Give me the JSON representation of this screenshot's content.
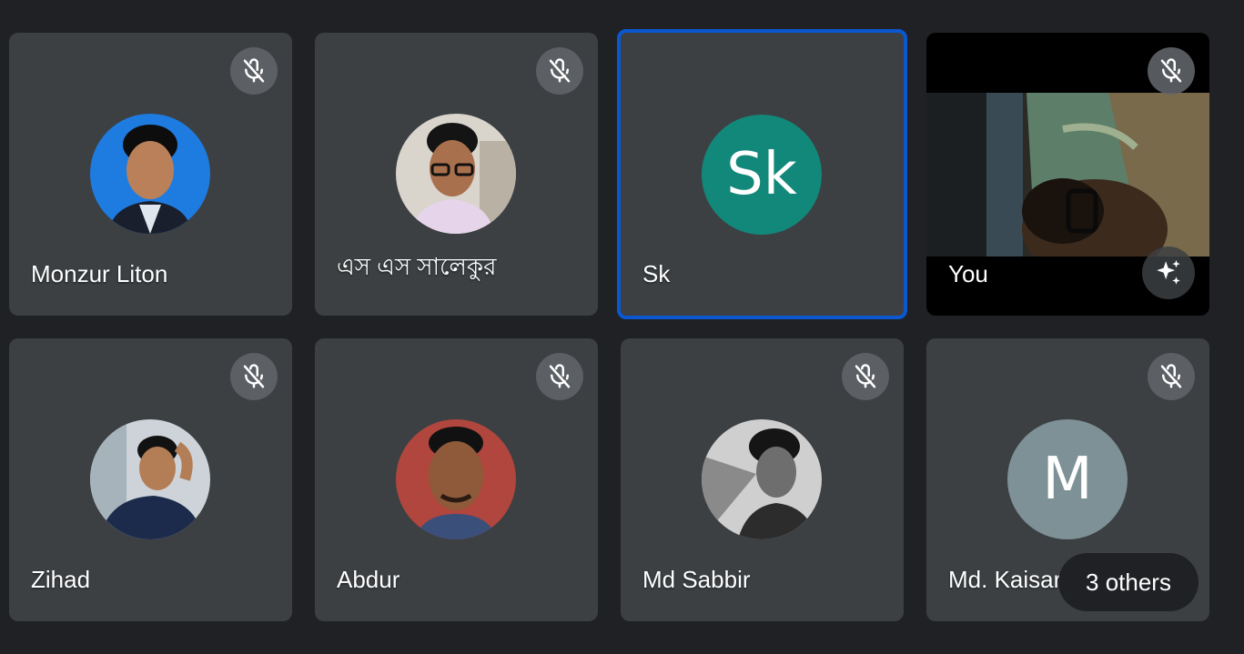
{
  "participants": [
    {
      "name": "Monzur Liton",
      "muted": true,
      "avatar_type": "photo"
    },
    {
      "name": "এস এস সালেকুর",
      "muted": true,
      "avatar_type": "photo"
    },
    {
      "name": "Sk",
      "muted": false,
      "speaking": true,
      "avatar_type": "letter",
      "initials": "Sk",
      "avatar_color": "#12887a"
    },
    {
      "name": "You",
      "muted": true,
      "avatar_type": "video",
      "self": true
    },
    {
      "name": "Zihad",
      "muted": true,
      "avatar_type": "photo"
    },
    {
      "name": "Abdur",
      "muted": true,
      "avatar_type": "photo"
    },
    {
      "name": "Md Sabbir",
      "muted": true,
      "avatar_type": "photo"
    },
    {
      "name": "Md. Kaisar",
      "muted": true,
      "avatar_type": "letter",
      "initials": "M",
      "avatar_color": "#7d9197"
    }
  ],
  "others": {
    "label": "3 others"
  },
  "icons": {
    "mute": "mic-off-icon",
    "effects": "sparkle-effects-icon"
  },
  "colors": {
    "background": "#202124",
    "tile": "#3c4043",
    "speaking_border": "#0b57d0"
  }
}
